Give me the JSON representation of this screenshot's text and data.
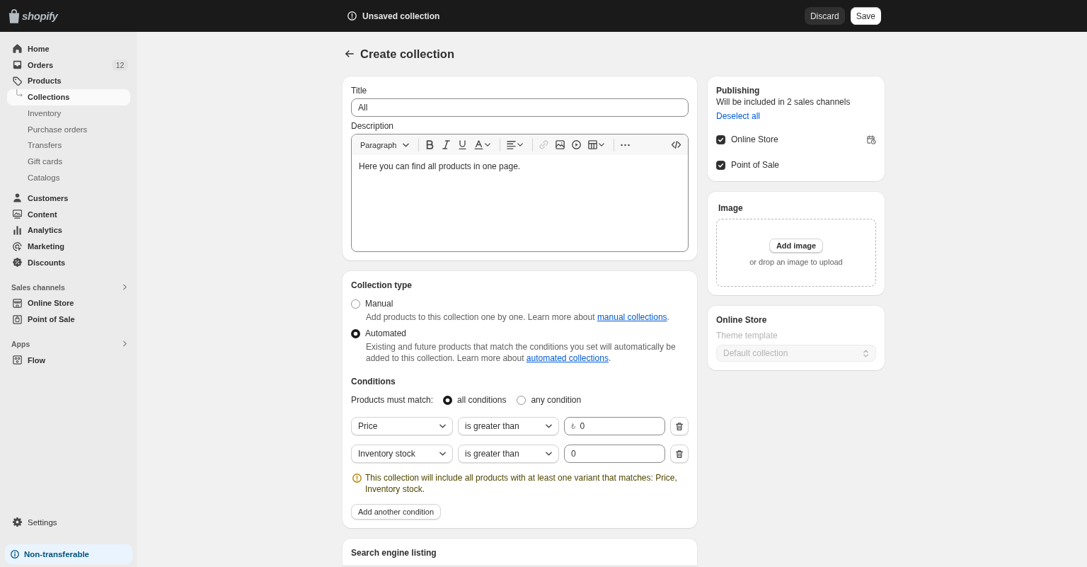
{
  "top_bar": {
    "brand": "shopify",
    "status": "Unsaved collection",
    "buttons": [
      {
        "label": "Discard",
        "kind": "secondary"
      },
      {
        "label": "Save",
        "kind": "primary"
      }
    ]
  },
  "sidebar": {
    "items": [
      {
        "label": "Home",
        "selected": false
      },
      {
        "label": "Orders",
        "badge": "12",
        "selected": false
      },
      {
        "label": "Products",
        "selected": false,
        "children": [
          {
            "label": "Collections",
            "selected": true
          },
          {
            "label": "Inventory",
            "selected": false
          },
          {
            "label": "Purchase orders",
            "selected": false
          },
          {
            "label": "Transfers",
            "selected": false
          },
          {
            "label": "Gift cards",
            "selected": false
          },
          {
            "label": "Catalogs",
            "selected": false
          }
        ]
      },
      {
        "label": "Customers",
        "selected": false
      },
      {
        "label": "Content",
        "selected": false
      },
      {
        "label": "Analytics",
        "selected": false
      },
      {
        "label": "Marketing",
        "selected": false
      },
      {
        "label": "Discounts",
        "selected": false
      }
    ],
    "sections": [
      {
        "title": "Sales channels",
        "items": [
          {
            "label": "Online Store",
            "selected": false
          },
          {
            "label": "Point of Sale",
            "selected": false
          }
        ]
      },
      {
        "title": "Apps",
        "items": [
          {
            "label": "Flow",
            "selected": false
          }
        ]
      }
    ],
    "settings": {
      "label": "Settings",
      "selected": false
    },
    "notice": "Non-transferable"
  },
  "page": {
    "title": "Create collection"
  },
  "details": {
    "title_label": "Title",
    "title_value": "All",
    "description_label": "Description",
    "format": "Paragraph",
    "link_disabled": true,
    "description": "Here you can find all products in one page."
  },
  "collection_type": {
    "title": "Collection type",
    "options": [
      {
        "label": "Manual",
        "selected": false,
        "help": "Add products to this collection one by one. Learn more about",
        "link": "manual collections",
        "after": "."
      },
      {
        "label": "Automated",
        "selected": true,
        "help": "Existing and future products that match the conditions you set will automatically be added to this collection. Learn more about",
        "link": "automated collections",
        "after": "."
      }
    ]
  },
  "conditions": {
    "title": "Conditions",
    "match_label": "Products must match:",
    "match_options": [
      {
        "label": "all conditions",
        "selected": true
      },
      {
        "label": "any condition",
        "selected": false
      }
    ],
    "rows": [
      {
        "field": "Price",
        "operator": "is greater than",
        "prefix": "₺",
        "value": "0"
      },
      {
        "field": "Inventory stock",
        "operator": "is greater than",
        "value": "0"
      }
    ],
    "note": "This collection will include all products with at least one variant that matches: Price, Inventory stock.",
    "add_button": "Add another condition"
  },
  "search_engine": {
    "title": "Search engine listing"
  },
  "publishing": {
    "title": "Publishing",
    "summary": "Will be included in 2 sales channels",
    "action": "Deselect all",
    "channels": [
      {
        "label": "Online Store",
        "checked": true,
        "schedule": true
      },
      {
        "label": "Point of Sale",
        "checked": true,
        "schedule": false
      }
    ]
  },
  "image": {
    "title": "Image",
    "button": "Add image",
    "hint": "or drop an image to upload"
  },
  "online_store": {
    "title": "Online Store",
    "template_label": "Theme template",
    "template_value": "Default collection",
    "disabled": true
  }
}
